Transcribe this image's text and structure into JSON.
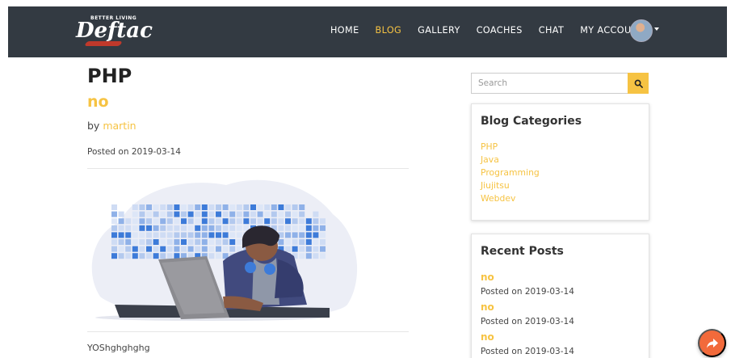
{
  "brand": {
    "tagline": "BETTER LIVING",
    "name": "Deftac"
  },
  "nav": {
    "items": [
      {
        "label": "HOME",
        "active": false
      },
      {
        "label": "BLOG",
        "active": true
      },
      {
        "label": "GALLERY",
        "active": false
      },
      {
        "label": "COACHES",
        "active": false
      },
      {
        "label": "CHAT",
        "active": false
      },
      {
        "label": "MY ACCOUNT",
        "active": false
      }
    ]
  },
  "post": {
    "title": "PHP",
    "subtitle": "no",
    "by_prefix": "by ",
    "author": "martin",
    "posted": "Posted on 2019-03-14",
    "excerpt": "YOShghghghg"
  },
  "search": {
    "placeholder": "Search"
  },
  "categories": {
    "title": "Blog Categories",
    "items": [
      "PHP",
      "Java",
      "Programming",
      "Jiujitsu",
      "Webdev"
    ]
  },
  "recent": {
    "title": "Recent Posts",
    "items": [
      {
        "title": "no",
        "date": "Posted on 2019-03-14"
      },
      {
        "title": "no",
        "date": "Posted on 2019-03-14"
      },
      {
        "title": "no",
        "date": "Posted on 2019-03-14"
      }
    ]
  },
  "colors": {
    "accent": "#f6c343",
    "navbar": "#333a42",
    "fab": "#f26a3b",
    "illustration_blue": "#3d7bd9"
  },
  "icons": {
    "search": "search-icon",
    "fab": "share-arrow-icon",
    "caret": "caret-down-icon"
  }
}
